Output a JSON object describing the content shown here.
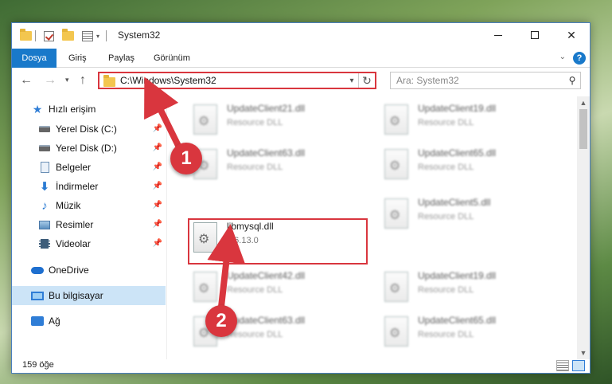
{
  "window": {
    "title": "System32",
    "colors": {
      "accent": "#1979ca",
      "highlight": "#d9363e",
      "selected": "#cce4f7"
    }
  },
  "ribbon": {
    "tabs": [
      "Dosya",
      "Giriş",
      "Paylaş",
      "Görünüm"
    ],
    "help_label": "?"
  },
  "navigation": {
    "address": "C:\\Windows\\System32",
    "search_placeholder": "Ara: System32"
  },
  "sidebar": {
    "items": [
      {
        "label": "Hızlı erişim",
        "icon": "star-icon",
        "pinned": false
      },
      {
        "label": "Yerel Disk (C:)",
        "icon": "drive-icon",
        "pinned": true
      },
      {
        "label": "Yerel Disk (D:)",
        "icon": "drive-icon",
        "pinned": true
      },
      {
        "label": "Belgeler",
        "icon": "document-icon",
        "pinned": true
      },
      {
        "label": "İndirmeler",
        "icon": "download-icon",
        "pinned": true
      },
      {
        "label": "Müzik",
        "icon": "music-icon",
        "pinned": true
      },
      {
        "label": "Resimler",
        "icon": "pictures-icon",
        "pinned": true
      },
      {
        "label": "Videolar",
        "icon": "video-icon",
        "pinned": true
      },
      {
        "label": "OneDrive",
        "icon": "cloud-icon",
        "pinned": false
      },
      {
        "label": "Bu bilgisayar",
        "icon": "computer-icon",
        "pinned": false,
        "selected": true
      },
      {
        "label": "Ağ",
        "icon": "network-icon",
        "pinned": false
      }
    ]
  },
  "files": {
    "left": [
      {
        "name": "UpdateClient21.dll",
        "sub": "Resource DLL"
      },
      {
        "name": "UpdateClient63.dll",
        "sub": "Resource DLL"
      },
      {
        "name": "libmysql.dll",
        "sub": "5.6.13.0",
        "highlighted": true
      },
      {
        "name": "UpdateClient42.dll",
        "sub": "Resource DLL"
      },
      {
        "name": "UpdateClient63.dll",
        "sub": "Resource DLL"
      }
    ],
    "right": [
      {
        "name": "UpdateClient19.dll",
        "sub": "Resource DLL"
      },
      {
        "name": "UpdateClient65.dll",
        "sub": "Resource DLL"
      },
      {
        "name": "UpdateClient5.dll",
        "sub": "Resource DLL"
      },
      {
        "name": "UpdateClient19.dll",
        "sub": "Resource DLL"
      },
      {
        "name": "UpdateClient65.dll",
        "sub": "Resource DLL"
      }
    ]
  },
  "status": {
    "item_count": "159 öğe"
  },
  "annotations": {
    "step1": "1",
    "step2": "2"
  }
}
